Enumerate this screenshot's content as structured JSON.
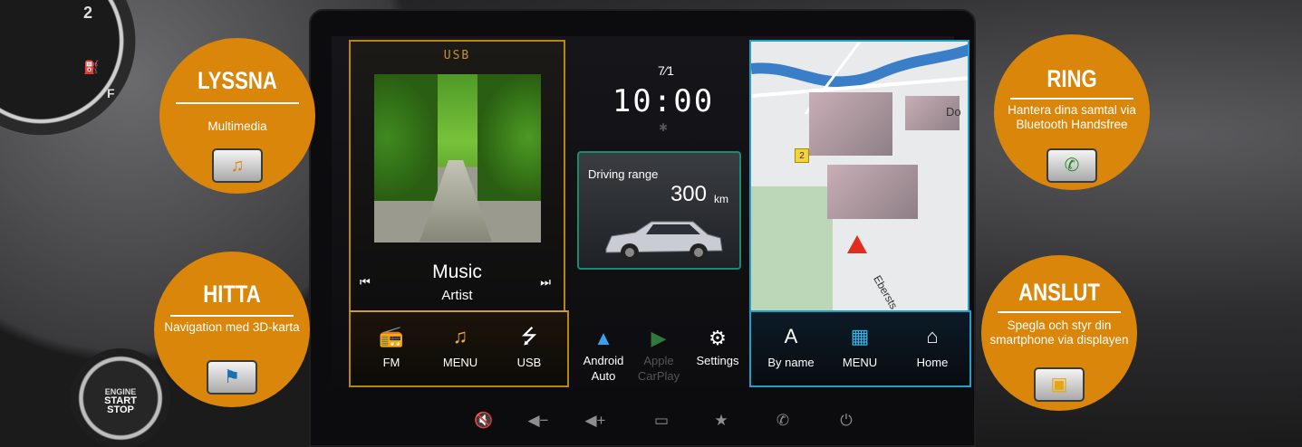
{
  "dashboard": {
    "gauge_number": "2",
    "gauge_f": "F",
    "gauge_e": "—",
    "start_button": [
      "ENGINE",
      "START",
      "STOP"
    ]
  },
  "music": {
    "source_label": "USB",
    "title": "Music",
    "artist": "Artist",
    "prev_icon": "⏮",
    "next_icon": "⏭",
    "bar": [
      {
        "label": "FM",
        "icon": "radio-icon",
        "glyph": "📻"
      },
      {
        "label": "MENU",
        "icon": "music-note-icon",
        "glyph": "♫"
      },
      {
        "label": "USB",
        "icon": "usb-icon",
        "glyph": "⭍"
      }
    ]
  },
  "status": {
    "date": "7∕​1",
    "time": "10:00",
    "bluetooth": "✱"
  },
  "range": {
    "label": "Driving range",
    "value": "300",
    "unit": "km"
  },
  "center_apps": [
    {
      "label_line1": "Android",
      "label_line2": "Auto",
      "icon": "android-auto-icon",
      "glyph": "▲",
      "active": true
    },
    {
      "label_line1": "Apple",
      "label_line2": "CarPlay",
      "icon": "apple-carplay-icon",
      "glyph": "▶",
      "active": false
    },
    {
      "label_line1": "Settings",
      "label_line2": "",
      "icon": "gear-icon",
      "glyph": "⚙",
      "active": true
    }
  ],
  "map": {
    "street_do": "Do",
    "street_eb": "Ebersts",
    "badge": "2",
    "bar": [
      {
        "label": "By name",
        "icon": "letter-a-icon",
        "glyph": "A"
      },
      {
        "label": "MENU",
        "icon": "grid-icon",
        "glyph": "▦"
      },
      {
        "label": "Home",
        "icon": "home-icon",
        "glyph": "⌂"
      }
    ]
  },
  "hardware_buttons": [
    {
      "name": "mute-icon",
      "glyph": "🔇"
    },
    {
      "name": "volume-down-icon",
      "glyph": "◀−"
    },
    {
      "name": "volume-up-icon",
      "glyph": "◀+"
    },
    {
      "name": "screen-icon",
      "glyph": "▭"
    },
    {
      "name": "star-icon",
      "glyph": "★"
    },
    {
      "name": "phone-icon",
      "glyph": "✆"
    },
    {
      "name": "power-icon",
      "glyph": "⏻"
    }
  ],
  "features": [
    {
      "title": "LYSSNA",
      "subtitle": "Multimedia",
      "icon": "multimedia-icon",
      "glyph": "♫"
    },
    {
      "title": "RING",
      "subtitle": "Hantera dina samtal via Bluetooth Handsfree",
      "icon": "phone-keypad-icon",
      "glyph": "✆"
    },
    {
      "title": "HITTA",
      "subtitle": "Navigation med 3D-karta",
      "icon": "navigation-icon",
      "glyph": "⚑"
    },
    {
      "title": "ANSLUT",
      "subtitle": "Spegla och styr din smartphone via displayen",
      "icon": "smartphone-connect-icon",
      "glyph": "▣"
    }
  ],
  "colors": {
    "feature_orange": "#d9860b",
    "music_accent": "#b8860b",
    "nav_accent": "#1fa0c8",
    "range_accent": "#1b8a6e"
  }
}
